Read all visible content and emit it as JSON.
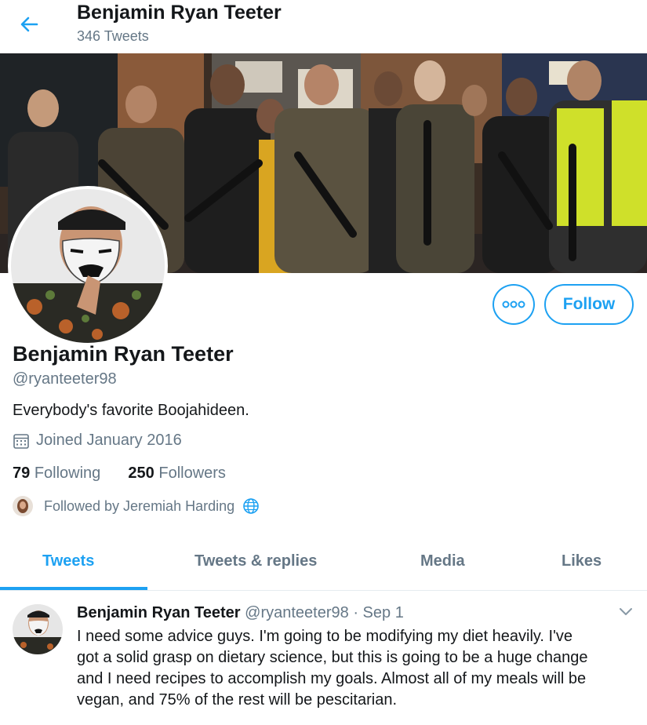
{
  "header": {
    "name": "Benjamin Ryan Teeter",
    "tweet_count": "346 Tweets"
  },
  "profile": {
    "name": "Benjamin Ryan Teeter",
    "handle": "@ryanteeter98",
    "bio": "Everybody's favorite Boojahideen.",
    "joined": "Joined January 2016",
    "following_count": "79",
    "following_label": "Following",
    "followers_count": "250",
    "followers_label": "Followers",
    "followed_by": "Followed by Jeremiah Harding",
    "follow_button": "Follow"
  },
  "tabs": [
    {
      "label": "Tweets"
    },
    {
      "label": "Tweets & replies"
    },
    {
      "label": "Media"
    },
    {
      "label": "Likes"
    }
  ],
  "tweet": {
    "author": "Benjamin Ryan Teeter",
    "handle": "@ryanteeter98",
    "date": "· Sep 1",
    "lines": [
      "I need some advice guys.  I'm going to be modifying my diet heavily.  I've",
      "got a solid grasp on dietary science, but this is going to be a huge change",
      "and I need recipes to accomplish my goals.  Almost all of my meals will be",
      "vegan, and 75% of the rest will be pescitarian."
    ]
  },
  "colors": {
    "accent": "#1da1f2",
    "secondary_text": "#657786"
  },
  "icons": [
    "back-arrow-icon",
    "more-dots-icon",
    "calendar-icon",
    "globe-icon",
    "chevron-down-icon"
  ]
}
